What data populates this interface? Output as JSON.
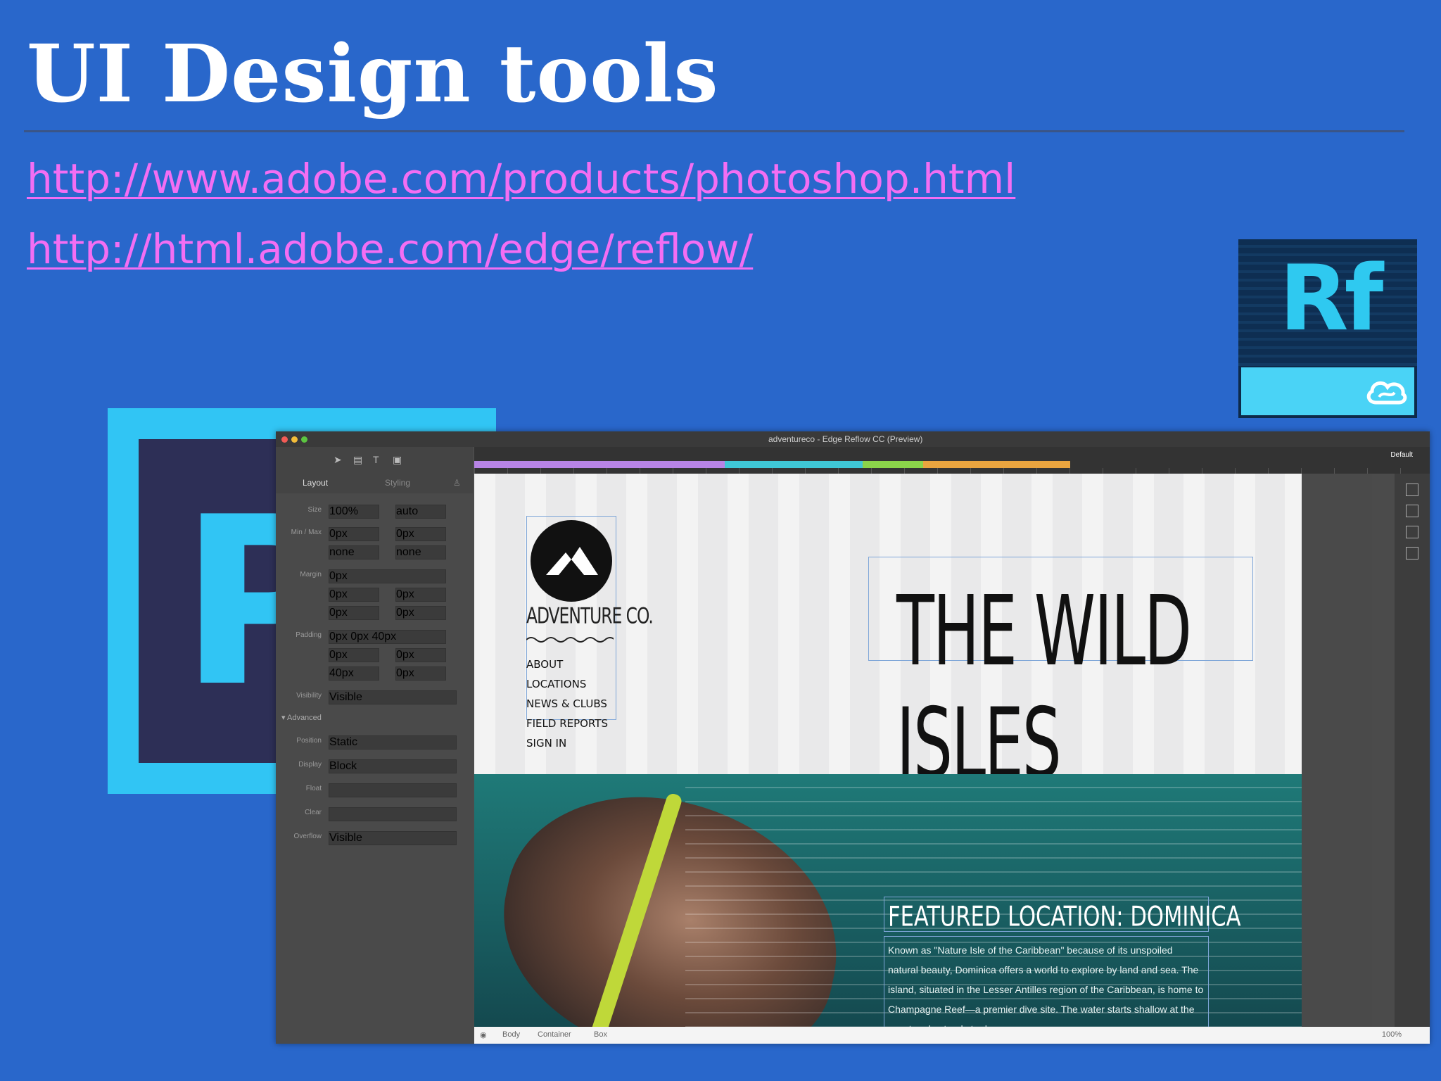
{
  "slide": {
    "title": "UI Design tools",
    "links": [
      "http://www.adobe.com/products/photoshop.html",
      "http://html.adobe.com/edge/reflow/"
    ]
  },
  "logos": {
    "reflow_text": "Rf",
    "photoshop_text": "P"
  },
  "app": {
    "window_title": "adventureco - Edge Reflow CC (Preview)",
    "tabs": [
      "Layout",
      "Styling"
    ],
    "properties": [
      {
        "label": "Size",
        "v1": "100%",
        "v2": "auto"
      },
      {
        "label": "Min / Max",
        "v1": "0px",
        "v2": "0px"
      },
      {
        "label": "",
        "v1": "none",
        "v2": "none"
      },
      {
        "label": "Margin",
        "v1": "0px",
        "v2": ""
      },
      {
        "label": "",
        "v1": "0px",
        "v2": "0px"
      },
      {
        "label": "",
        "v1": "0px",
        "v2": "0px"
      },
      {
        "label": "Padding",
        "v1": "0px 0px 40px",
        "v2": ""
      },
      {
        "label": "",
        "v1": "0px",
        "v2": "0px"
      },
      {
        "label": "",
        "v1": "40px",
        "v2": "0px"
      },
      {
        "label": "Visibility",
        "v1": "Visible",
        "v2": ""
      }
    ],
    "advanced_label": "Advanced",
    "advanced": [
      {
        "label": "Position",
        "v1": "Static"
      },
      {
        "label": "Display",
        "v1": "Block"
      },
      {
        "label": "Float",
        "v1": ""
      },
      {
        "label": "Clear",
        "v1": ""
      },
      {
        "label": "Overflow",
        "v1": "Visible"
      }
    ],
    "ruler_default": "Default",
    "breakpoints": [
      {
        "color": "#b884e6",
        "width": 0.29
      },
      {
        "color": "#3fc7d6",
        "width": 0.16
      },
      {
        "color": "#8bd44a",
        "width": 0.07
      },
      {
        "color": "#e9a43f",
        "width": 0.17
      }
    ],
    "statusbar": {
      "crumbs": [
        "Body",
        "Container",
        "Box"
      ],
      "zoom": "100%"
    }
  },
  "site": {
    "brand": "ADVENTURE CO.",
    "nav": [
      "ABOUT",
      "LOCATIONS",
      "NEWS & CLUBS",
      "FIELD REPORTS",
      "SIGN IN"
    ],
    "hero_title": "THE WILD ISLES",
    "featured_title": "FEATURED LOCATION: DOMINICA",
    "featured_body": "Known as \"Nature Isle of the Caribbean\" because of its unspoiled natural beauty, Dominica offers a world to explore by land and sea. The island, situated in the Lesser Antilles region of the Caribbean, is home to Champagne Reef—a premier dive site. The water starts shallow at the coast and extends to deeper"
  }
}
